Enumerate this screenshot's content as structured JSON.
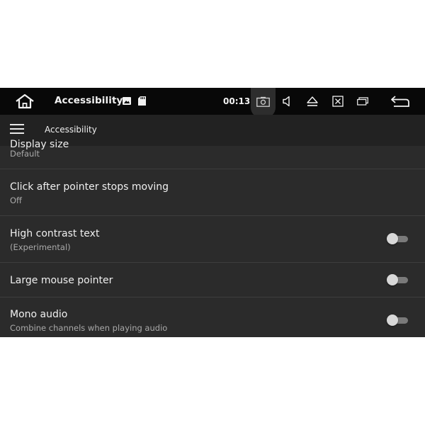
{
  "statusbar": {
    "title": "Accessibility",
    "time": "00:13"
  },
  "appbar": {
    "title": "Accessibility"
  },
  "settings": {
    "partial_item": {
      "title": "Display size",
      "subtitle": "Default"
    },
    "click_after_stop": {
      "title": "Click after pointer stops moving",
      "subtitle": "Off"
    },
    "high_contrast": {
      "title": "High contrast text",
      "subtitle": "(Experimental)",
      "enabled": false
    },
    "large_pointer": {
      "title": "Large mouse pointer",
      "enabled": false
    },
    "mono_audio": {
      "title": "Mono audio",
      "subtitle": "Combine channels when playing audio",
      "enabled": false
    }
  },
  "icons": {
    "status": [
      "home-icon",
      "image-icon",
      "sd-card-icon",
      "screenshot-icon",
      "volume-icon",
      "eject-icon",
      "close-window-icon",
      "window-icon",
      "back-icon"
    ],
    "appbar": [
      "menu-icon"
    ]
  },
  "colors": {
    "statusbar_bg": "#080808",
    "appbar_bg": "#222222",
    "list_bg": "#2b2b2b",
    "divider": "#3d3d3d",
    "text_primary": "#f0f0f0",
    "text_secondary": "#a9a9a9"
  }
}
